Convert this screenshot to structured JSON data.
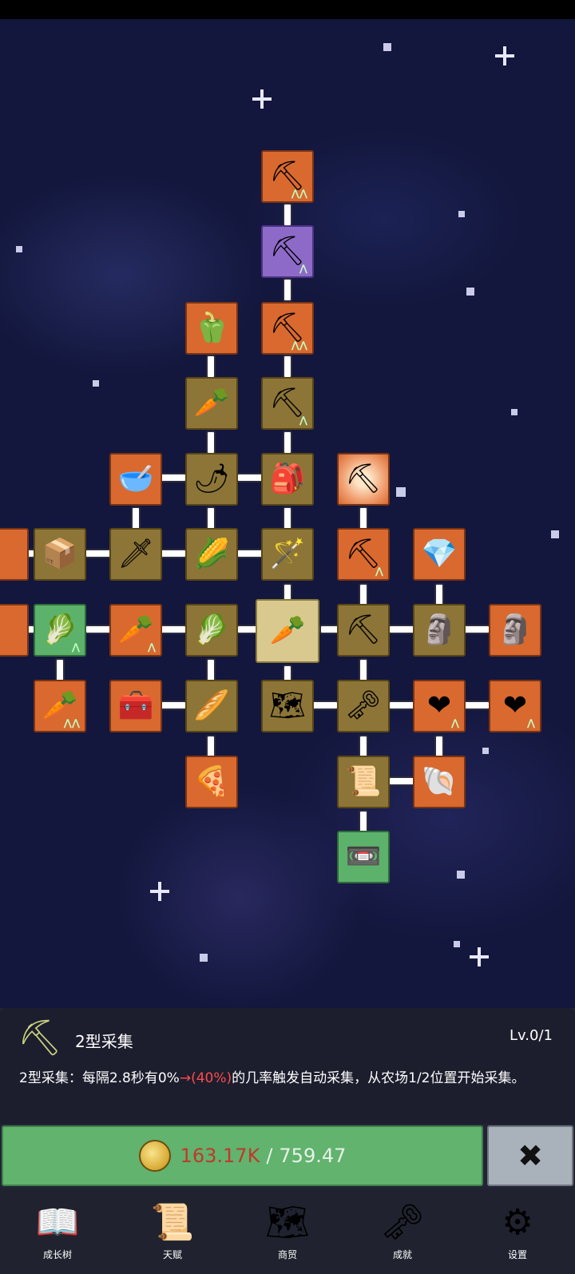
{
  "skill_tree": {
    "nodes": [
      {
        "id": "shovel-speed-3",
        "icon": "shovel-icon",
        "glyph": "⛏",
        "color": "orange",
        "upgrade": "⋀⋀"
      },
      {
        "id": "magic-shovel",
        "icon": "magic-shovel-icon",
        "glyph": "⛏",
        "color": "purple",
        "upgrade": "⋀"
      },
      {
        "id": "shovel-speed-2",
        "icon": "shovel-icon",
        "glyph": "⛏",
        "color": "orange",
        "upgrade": "⋀⋀"
      },
      {
        "id": "pepper",
        "icon": "bell-pepper-icon",
        "glyph": "🫑",
        "color": "orange",
        "upgrade": ""
      },
      {
        "id": "shovel-1",
        "icon": "shovel-icon",
        "glyph": "⛏",
        "color": "brown",
        "upgrade": "⋀"
      },
      {
        "id": "daikon",
        "icon": "radish-icon",
        "glyph": "🥕",
        "color": "brown",
        "upgrade": ""
      },
      {
        "id": "bowl",
        "icon": "bowl-icon",
        "glyph": "🥣",
        "color": "orange",
        "upgrade": ""
      },
      {
        "id": "chili",
        "icon": "chili-icon",
        "glyph": "🌶",
        "color": "brown",
        "upgrade": ""
      },
      {
        "id": "backpack",
        "icon": "backpack-icon",
        "glyph": "🎒",
        "color": "brown",
        "upgrade": ""
      },
      {
        "id": "pickaxe-type2",
        "icon": "pickaxe-icon",
        "glyph": "⛏",
        "color": "glow",
        "upgrade": ""
      },
      {
        "id": "edge-left-1",
        "icon": "partial-node-icon",
        "glyph": "",
        "color": "orange",
        "upgrade": ""
      },
      {
        "id": "crate",
        "icon": "crate-icon",
        "glyph": "📦",
        "color": "brown",
        "upgrade": ""
      },
      {
        "id": "sword",
        "icon": "sword-icon",
        "glyph": "🗡",
        "color": "brown",
        "upgrade": ""
      },
      {
        "id": "corn",
        "icon": "corn-icon",
        "glyph": "🌽",
        "color": "brown",
        "upgrade": ""
      },
      {
        "id": "staff",
        "icon": "staff-icon",
        "glyph": "🪄",
        "color": "brown",
        "upgrade": ""
      },
      {
        "id": "pickaxe-2",
        "icon": "pickaxe-icon",
        "glyph": "⛏",
        "color": "orange",
        "upgrade": "⋀"
      },
      {
        "id": "crystal",
        "icon": "crystal-icon",
        "glyph": "💎",
        "color": "orange",
        "upgrade": ""
      },
      {
        "id": "edge-left-2",
        "icon": "partial-node-icon",
        "glyph": "",
        "color": "orange",
        "upgrade": ""
      },
      {
        "id": "cabbage-2",
        "icon": "cabbage-icon",
        "glyph": "🥬",
        "color": "green",
        "upgrade": "⋀"
      },
      {
        "id": "carrot-2",
        "icon": "carrot-icon",
        "glyph": "🥕",
        "color": "orange",
        "upgrade": "⋀"
      },
      {
        "id": "cabbage-1",
        "icon": "cabbage-icon",
        "glyph": "🥬",
        "color": "brown",
        "upgrade": ""
      },
      {
        "id": "carrot-root",
        "icon": "carrot-icon",
        "glyph": "🥕",
        "color": "selected",
        "upgrade": ""
      },
      {
        "id": "pickaxe-1",
        "icon": "pickaxe-icon",
        "glyph": "⛏",
        "color": "brown",
        "upgrade": ""
      },
      {
        "id": "statue-1",
        "icon": "statue-icon",
        "glyph": "🗿",
        "color": "brown",
        "upgrade": ""
      },
      {
        "id": "statue-2",
        "icon": "statue-icon",
        "glyph": "🗿",
        "color": "orange",
        "upgrade": ""
      },
      {
        "id": "carrot-3",
        "icon": "carrot-icon",
        "glyph": "🥕",
        "color": "orange",
        "upgrade": "⋀⋀"
      },
      {
        "id": "chest",
        "icon": "treasure-chest-icon",
        "glyph": "🧰",
        "color": "orange",
        "upgrade": ""
      },
      {
        "id": "parsnip",
        "icon": "parsnip-icon",
        "glyph": "🥖",
        "color": "brown",
        "upgrade": ""
      },
      {
        "id": "map",
        "icon": "map-icon",
        "glyph": "🗺",
        "color": "brown",
        "upgrade": ""
      },
      {
        "id": "key",
        "icon": "key-icon",
        "glyph": "🗝",
        "color": "brown",
        "upgrade": ""
      },
      {
        "id": "heart-1",
        "icon": "heart-icon",
        "glyph": "❤",
        "color": "orange",
        "upgrade": "⋀"
      },
      {
        "id": "heart-2",
        "icon": "heart-icon",
        "glyph": "❤",
        "color": "orange",
        "upgrade": "⋀"
      },
      {
        "id": "pizza",
        "icon": "pizza-icon",
        "glyph": "🍕",
        "color": "orange",
        "upgrade": ""
      },
      {
        "id": "scroll",
        "icon": "scroll-icon",
        "glyph": "📜",
        "color": "brown",
        "upgrade": ""
      },
      {
        "id": "fossil",
        "icon": "fossil-icon",
        "glyph": "🐚",
        "color": "orange",
        "upgrade": ""
      },
      {
        "id": "cassette",
        "icon": "cassette-icon",
        "glyph": "📼",
        "color": "green",
        "upgrade": ""
      }
    ]
  },
  "detail": {
    "icon": "pickaxe-icon",
    "name": "2型采集",
    "level": "Lv.0/1",
    "desc_prefix": "2型采集：每隔2.8秒有0%",
    "desc_arrow": "→",
    "desc_after": "(40%)",
    "desc_suffix": "的几率触发自动采集，从农场1/2位置开始采集。"
  },
  "purchase": {
    "coin_icon": "gold-coin-icon",
    "current": "163.17K",
    "separator": "/",
    "required": "759.47",
    "close_glyph": "✖"
  },
  "nav": [
    {
      "icon": "book-icon",
      "glyph": "📖",
      "label": "成长树"
    },
    {
      "icon": "scroll-icon",
      "glyph": "📜",
      "label": "天赋"
    },
    {
      "icon": "map-icon",
      "glyph": "🗺",
      "label": "商贸"
    },
    {
      "icon": "key-icon",
      "glyph": "🗝",
      "label": "成就"
    },
    {
      "icon": "gear-icon",
      "glyph": "⚙",
      "label": "设置"
    }
  ],
  "colors": {
    "background": "#13173d",
    "node_brown": "#8c7537",
    "node_orange": "#d9692f",
    "node_green": "#5db26b",
    "buy_button": "#61b36e",
    "price_short": "#c0392b",
    "boost_text": "#ff4b4b"
  }
}
